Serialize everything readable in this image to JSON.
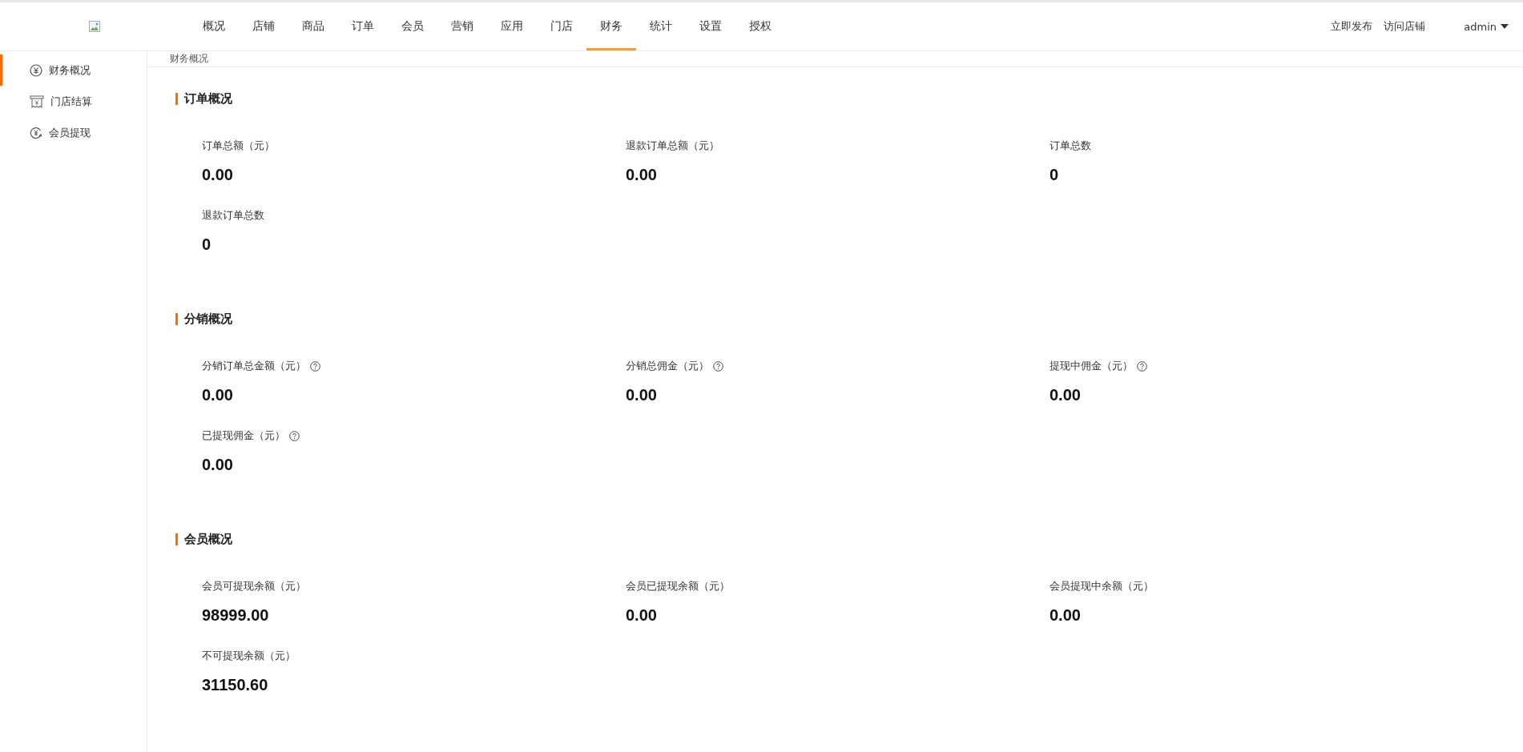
{
  "nav": [
    {
      "label": "概况",
      "selected": false
    },
    {
      "label": "店铺",
      "selected": false
    },
    {
      "label": "商品",
      "selected": false
    },
    {
      "label": "订单",
      "selected": false
    },
    {
      "label": "会员",
      "selected": false
    },
    {
      "label": "营销",
      "selected": false
    },
    {
      "label": "应用",
      "selected": false
    },
    {
      "label": "门店",
      "selected": false
    },
    {
      "label": "财务",
      "selected": true
    },
    {
      "label": "统计",
      "selected": false
    },
    {
      "label": "设置",
      "selected": false
    },
    {
      "label": "授权",
      "selected": false
    }
  ],
  "header_links": [
    "立即发布",
    "访问店铺"
  ],
  "user": {
    "name": "admin"
  },
  "sidebar": {
    "items": [
      {
        "label": "财务概况",
        "kind": "yuan",
        "selected": true
      },
      {
        "label": "门店结算",
        "kind": "shop",
        "selected": false
      },
      {
        "label": "会员提现",
        "kind": "withdraw",
        "selected": false
      }
    ]
  },
  "breadcrumb": "财务概况",
  "sections": [
    {
      "title": "订单概况",
      "stats": [
        {
          "label": "订单总额（元）",
          "value": "0.00",
          "help": false
        },
        {
          "label": "退款订单总额（元）",
          "value": "0.00",
          "help": false
        },
        {
          "label": "订单总数",
          "value": "0",
          "help": false
        },
        {
          "label": "退款订单总数",
          "value": "0",
          "help": false
        }
      ]
    },
    {
      "title": "分销概况",
      "stats": [
        {
          "label": "分销订单总金额（元）",
          "value": "0.00",
          "help": true
        },
        {
          "label": "分销总佣金（元）",
          "value": "0.00",
          "help": true
        },
        {
          "label": "提现中佣金（元）",
          "value": "0.00",
          "help": true
        },
        {
          "label": "已提现佣金（元）",
          "value": "0.00",
          "help": true
        }
      ]
    },
    {
      "title": "会员概况",
      "stats": [
        {
          "label": "会员可提现余额（元）",
          "value": "98999.00",
          "help": false
        },
        {
          "label": "会员已提现余额（元）",
          "value": "0.00",
          "help": false
        },
        {
          "label": "会员提现中余额（元）",
          "value": "0.00",
          "help": false
        },
        {
          "label": "不可提现余额（元）",
          "value": "31150.60",
          "help": false
        }
      ]
    }
  ]
}
